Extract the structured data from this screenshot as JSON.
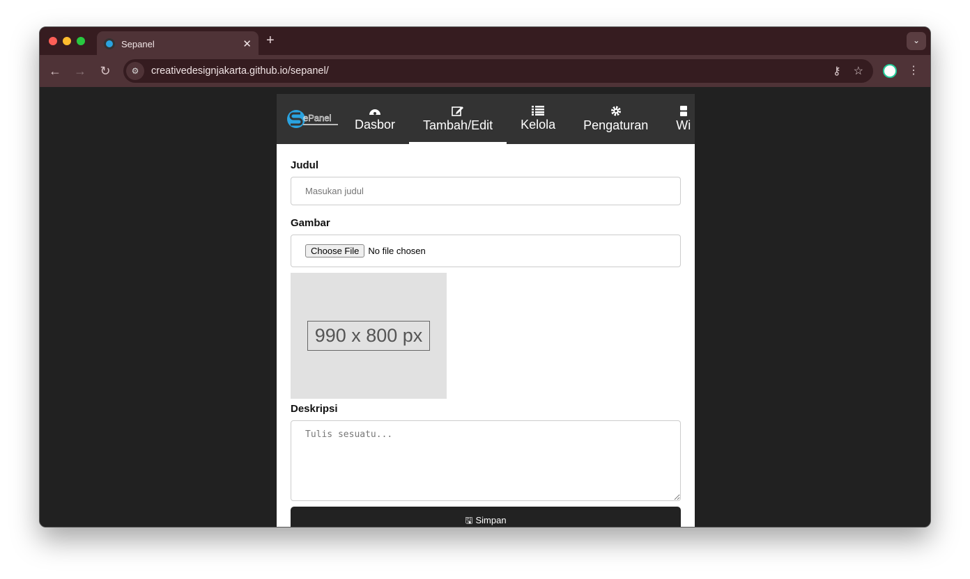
{
  "browser": {
    "tab_title": "Sepanel",
    "url": "creativedesignjakarta.github.io/sepanel/"
  },
  "nav": {
    "logo_text": "SePanel",
    "items": [
      {
        "label": "Dasbor",
        "icon": "dashboard-icon"
      },
      {
        "label": "Tambah/Edit",
        "icon": "edit-icon",
        "active": true
      },
      {
        "label": "Kelola",
        "icon": "list-icon"
      },
      {
        "label": "Pengaturan",
        "icon": "gear-icon"
      },
      {
        "label": "Wi",
        "icon": "widget-icon"
      }
    ]
  },
  "form": {
    "title_label": "Judul",
    "title_placeholder": "Masukan judul",
    "image_label": "Gambar",
    "choose_file": "Choose File",
    "no_file": "No file chosen",
    "image_placeholder": "990 x 800 px",
    "desc_label": "Deskripsi",
    "desc_placeholder": "Tulis sesuatu...",
    "save_label": "Simpan"
  },
  "colors": {
    "menu_bg": "#333333",
    "page_bg": "#212121",
    "button_bg": "#222222",
    "browser_frame": "#4f3337"
  }
}
